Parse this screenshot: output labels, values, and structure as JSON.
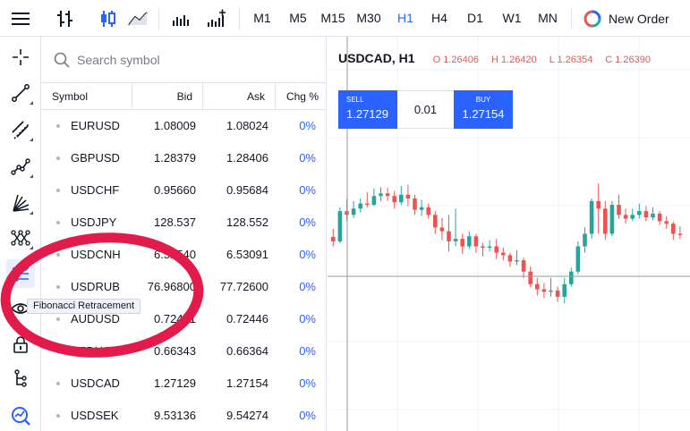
{
  "toolbar": {
    "timeframes": [
      "M1",
      "M5",
      "M15",
      "M30",
      "H1",
      "H4",
      "D1",
      "W1",
      "MN"
    ],
    "active_timeframe": "H1",
    "new_order_label": "New Order"
  },
  "search": {
    "placeholder": "Search symbol"
  },
  "table": {
    "headers": {
      "symbol": "Symbol",
      "bid": "Bid",
      "ask": "Ask",
      "chg": "Chg %"
    },
    "rows": [
      {
        "symbol": "EURUSD",
        "bid": "1.08009",
        "ask": "1.08024",
        "chg": "0%"
      },
      {
        "symbol": "GBPUSD",
        "bid": "1.28379",
        "ask": "1.28406",
        "chg": "0%"
      },
      {
        "symbol": "USDCHF",
        "bid": "0.95660",
        "ask": "0.95684",
        "chg": "0%"
      },
      {
        "symbol": "USDJPY",
        "bid": "128.537",
        "ask": "128.552",
        "chg": "0%"
      },
      {
        "symbol": "USDCNH",
        "bid": "6.52540",
        "ask": "6.53091",
        "chg": "0%"
      },
      {
        "symbol": "USDRUB",
        "bid": "76.96800",
        "ask": "77.72600",
        "chg": "0%"
      },
      {
        "symbol": "AUDUSD",
        "bid": "0.72431",
        "ask": "0.72446",
        "chg": "0%"
      },
      {
        "symbol": "NZDUSD",
        "bid": "0.66343",
        "ask": "0.66364",
        "chg": "0%"
      },
      {
        "symbol": "USDCAD",
        "bid": "1.27129",
        "ask": "1.27154",
        "chg": "0%"
      },
      {
        "symbol": "USDSEK",
        "bid": "9.53136",
        "ask": "9.54274",
        "chg": "0%"
      }
    ]
  },
  "chart": {
    "symbol": "USDCAD",
    "timeframe": "H1",
    "ohlc": {
      "o": "O 1.26406",
      "h": "H 1.26420",
      "l": "L 1.26354",
      "c": "C 1.26390"
    },
    "sell_label": "SELL",
    "sell_price": "1.27129",
    "quantity": "0.01",
    "buy_label": "BUY",
    "buy_price": "1.27154",
    "up_color": "#26a69a",
    "down_color": "#ef5350",
    "candles": [
      [
        1.2655,
        1.2648,
        1.2668,
        1.264
      ],
      [
        1.2648,
        1.2696,
        1.2702,
        1.2645
      ],
      [
        1.2696,
        1.269,
        1.2715,
        1.268
      ],
      [
        1.269,
        1.27,
        1.2712,
        1.2685
      ],
      [
        1.27,
        1.2708,
        1.2716,
        1.2694
      ],
      [
        1.2708,
        1.2706,
        1.2726,
        1.2702
      ],
      [
        1.2706,
        1.272,
        1.2732,
        1.2704
      ],
      [
        1.272,
        1.2724,
        1.2734,
        1.2712
      ],
      [
        1.2724,
        1.272,
        1.2733,
        1.2712
      ],
      [
        1.272,
        1.271,
        1.2728,
        1.27
      ],
      [
        1.271,
        1.2722,
        1.2736,
        1.2706
      ],
      [
        1.2722,
        1.2716,
        1.2738,
        1.2704
      ],
      [
        1.2716,
        1.2698,
        1.2722,
        1.269
      ],
      [
        1.2698,
        1.2702,
        1.2714,
        1.2688
      ],
      [
        1.2702,
        1.269,
        1.2708,
        1.2684
      ],
      [
        1.269,
        1.267,
        1.2696,
        1.266
      ],
      [
        1.267,
        1.2664,
        1.2685,
        1.265
      ],
      [
        1.2664,
        1.2648,
        1.269,
        1.2632
      ],
      [
        1.2648,
        1.2652,
        1.27,
        1.264
      ],
      [
        1.2652,
        1.264,
        1.266,
        1.2628
      ],
      [
        1.264,
        1.2656,
        1.2664,
        1.2636
      ],
      [
        1.2656,
        1.264,
        1.266,
        1.263
      ],
      [
        1.264,
        1.2638,
        1.2646,
        1.2624
      ],
      [
        1.2638,
        1.264,
        1.265,
        1.2632
      ],
      [
        1.264,
        1.263,
        1.2652,
        1.262
      ],
      [
        1.263,
        1.2626,
        1.2638,
        1.2618
      ],
      [
        1.2626,
        1.2616,
        1.263,
        1.2608
      ],
      [
        1.2616,
        1.2618,
        1.2634,
        1.261
      ],
      [
        1.2618,
        1.26,
        1.2622,
        1.259
      ],
      [
        1.26,
        1.258,
        1.2608,
        1.2575
      ],
      [
        1.258,
        1.2572,
        1.259,
        1.2562
      ],
      [
        1.2572,
        1.2568,
        1.2582,
        1.2558
      ],
      [
        1.2568,
        1.257,
        1.259,
        1.256
      ],
      [
        1.257,
        1.256,
        1.2576,
        1.2552
      ],
      [
        1.256,
        1.258,
        1.259,
        1.255
      ],
      [
        1.258,
        1.26,
        1.2606,
        1.2576
      ],
      [
        1.26,
        1.264,
        1.2648,
        1.2596
      ],
      [
        1.264,
        1.266,
        1.267,
        1.263
      ],
      [
        1.266,
        1.2712,
        1.2716,
        1.2652
      ],
      [
        1.2712,
        1.27,
        1.274,
        1.266
      ],
      [
        1.27,
        1.266,
        1.2712,
        1.265
      ],
      [
        1.266,
        1.2706,
        1.2712,
        1.2656
      ],
      [
        1.2706,
        1.269,
        1.2722,
        1.2684
      ],
      [
        1.269,
        1.2684,
        1.27,
        1.2676
      ],
      [
        1.2684,
        1.269,
        1.27,
        1.268
      ],
      [
        1.269,
        1.2696,
        1.2708,
        1.2684
      ],
      [
        1.2696,
        1.2686,
        1.2704,
        1.268
      ],
      [
        1.2686,
        1.2692,
        1.2702,
        1.2682
      ],
      [
        1.2692,
        1.268,
        1.2696,
        1.2674
      ],
      [
        1.268,
        1.2676,
        1.2688,
        1.2668
      ],
      [
        1.2676,
        1.266,
        1.268,
        1.265
      ],
      [
        1.266,
        1.2658,
        1.2672,
        1.2652
      ]
    ]
  },
  "tooltip": {
    "text": "Fibonacci Retracement"
  },
  "annotation_color": "#e31b4b"
}
